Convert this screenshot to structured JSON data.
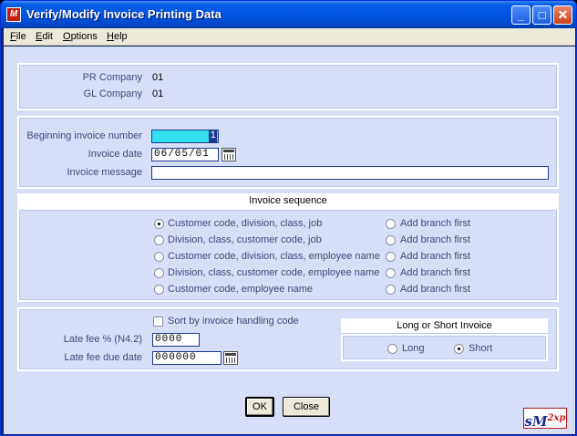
{
  "window": {
    "title": "Verify/Modify Invoice Printing Data"
  },
  "menu": [
    {
      "mnemonic": "F",
      "rest": "ile"
    },
    {
      "mnemonic": "E",
      "rest": "dit"
    },
    {
      "mnemonic": "O",
      "rest": "ptions"
    },
    {
      "mnemonic": "H",
      "rest": "elp"
    }
  ],
  "company": {
    "pr_label": "PR Company",
    "pr_value": "01",
    "gl_label": "GL Company",
    "gl_value": "01"
  },
  "invoice": {
    "begin_label": "Beginning invoice number",
    "begin_value": "1",
    "date_label": "Invoice date",
    "date_value": "06/05/01",
    "message_label": "Invoice message",
    "message_value": ""
  },
  "sequence": {
    "title": "Invoice sequence",
    "options": [
      {
        "label": "Customer code, division, class, job",
        "selected": true,
        "branch": "Add branch first"
      },
      {
        "label": "Division, class, customer code, job",
        "selected": false,
        "branch": "Add branch first"
      },
      {
        "label": "Customer code, division, class, employee name",
        "selected": false,
        "branch": "Add branch first"
      },
      {
        "label": "Division, class, customer code, employee name",
        "selected": false,
        "branch": "Add branch first"
      },
      {
        "label": "Customer code, employee name",
        "selected": false,
        "branch": "Add branch first"
      }
    ]
  },
  "fees": {
    "sort_label": "Sort by invoice handling code",
    "late_fee_label": "Late fee % (N4.2)",
    "late_fee_value": "0000",
    "due_date_label": "Late fee due date",
    "due_date_value": "000000"
  },
  "invoice_type": {
    "title": "Long or Short Invoice",
    "long_label": "Long",
    "short_label": "Short",
    "selected": "Short"
  },
  "buttons": {
    "ok": "OK",
    "close": "Close"
  },
  "logo": {
    "main": "sM",
    "sub": "2xp"
  }
}
